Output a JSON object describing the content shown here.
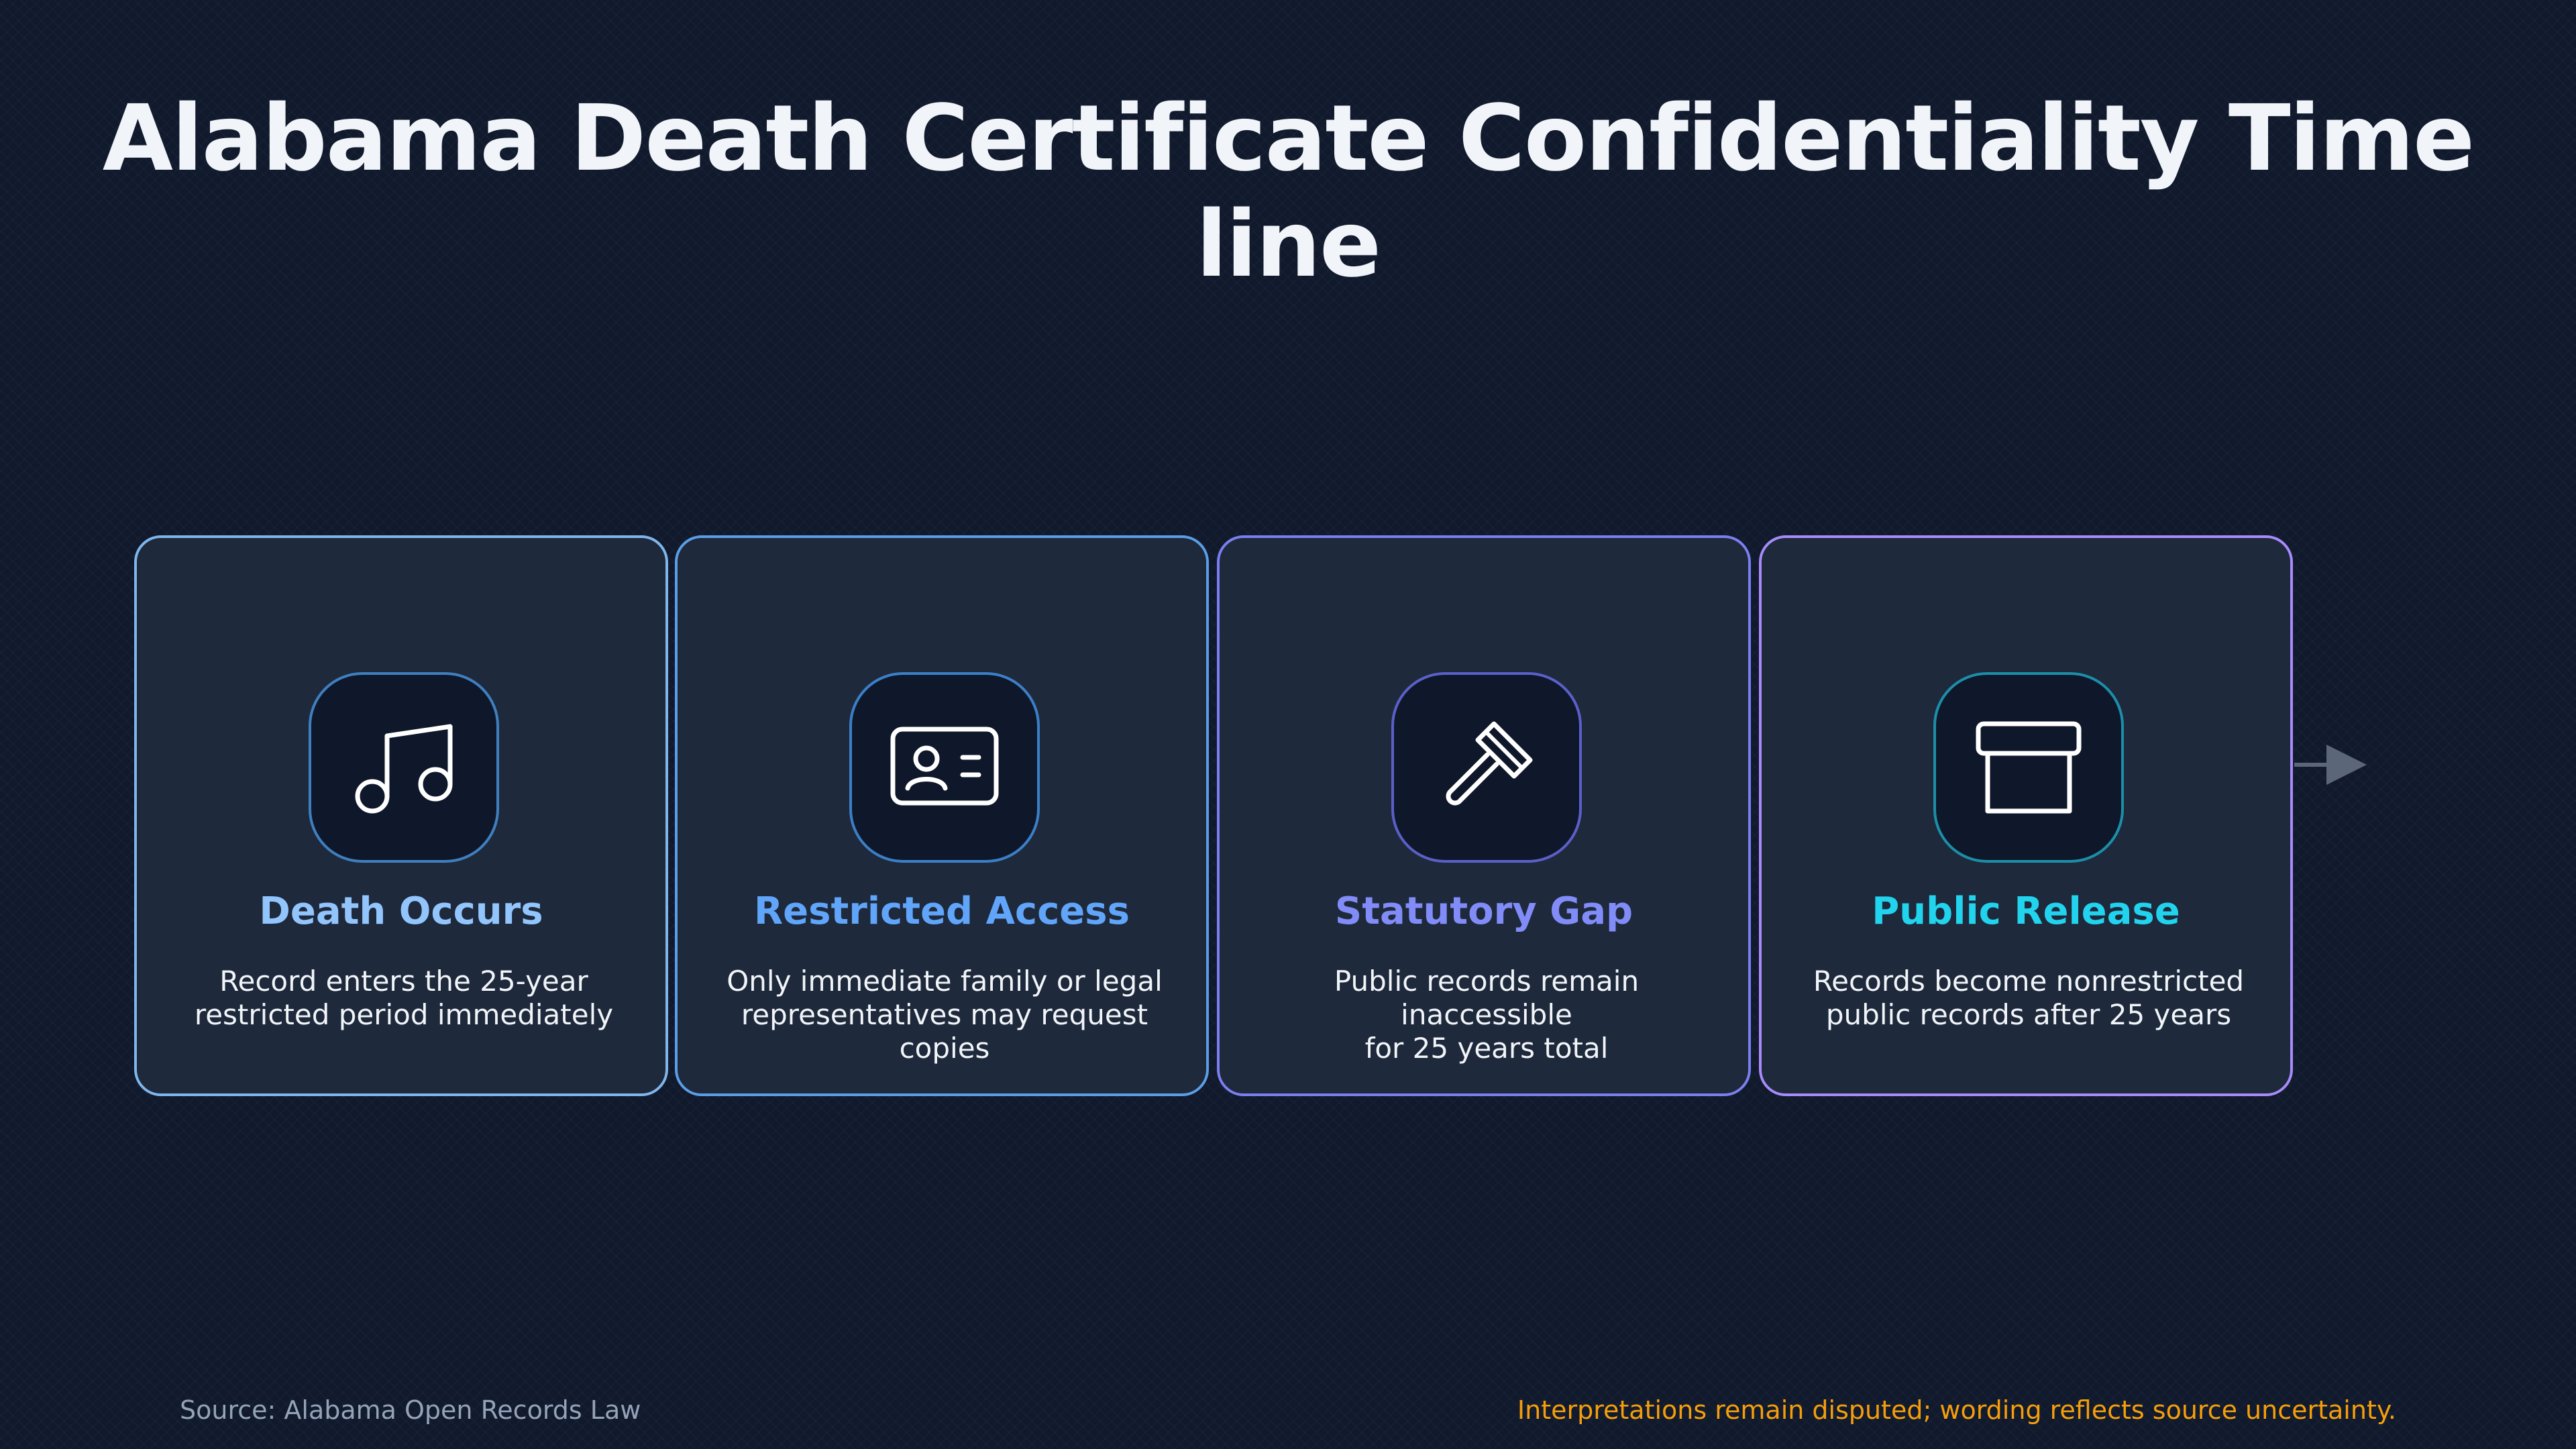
{
  "title": "Alabama Death Certificate Confidentiality Time line",
  "steps": [
    {
      "title": "Death Occurs",
      "line1": "Record enters the 25-year",
      "line2": "restricted period immediately",
      "icon": "music-note-icon",
      "accent": "#93c5fd"
    },
    {
      "title": "Restricted Access",
      "line1": "Only immediate family or legal",
      "line2": "representatives may request copies",
      "icon": "id-card-icon",
      "accent": "#60a5fa"
    },
    {
      "title": "Statutory Gap",
      "line1": "Public records remain inaccessible",
      "line2": "for 25 years total",
      "icon": "gavel-icon",
      "accent": "#818cf8"
    },
    {
      "title": "Public Release",
      "line1": "Records become nonrestricted",
      "line2": "public records after 25 years",
      "icon": "archive-box-icon",
      "accent": "#22d3ee"
    }
  ],
  "footer": {
    "source": "Source: Alabama Open Records Law",
    "note": "Interpretations remain disputed; wording reflects source uncertainty."
  }
}
